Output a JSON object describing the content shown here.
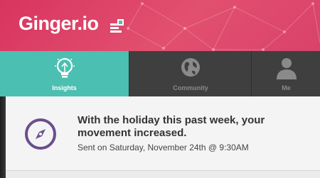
{
  "app": {
    "title": "Ginger.io",
    "notification_icon": "notification-icon",
    "brand_color": "#d8345f"
  },
  "tabs": [
    {
      "label": "Insights",
      "icon": "lightbulb-icon",
      "active": true
    },
    {
      "label": "Community",
      "icon": "globe-icon",
      "active": false
    },
    {
      "label": "Me",
      "icon": "person-icon",
      "active": false
    }
  ],
  "insight": {
    "icon": "compass-icon",
    "title": "With the holiday this past week, your movement increased.",
    "meta": "Sent on Saturday, November 24th @ 9:30AM",
    "accent_color": "#6b4e8e"
  },
  "colors": {
    "active_tab": "#4bbfb1",
    "tab_bar": "#3f3f3f"
  }
}
